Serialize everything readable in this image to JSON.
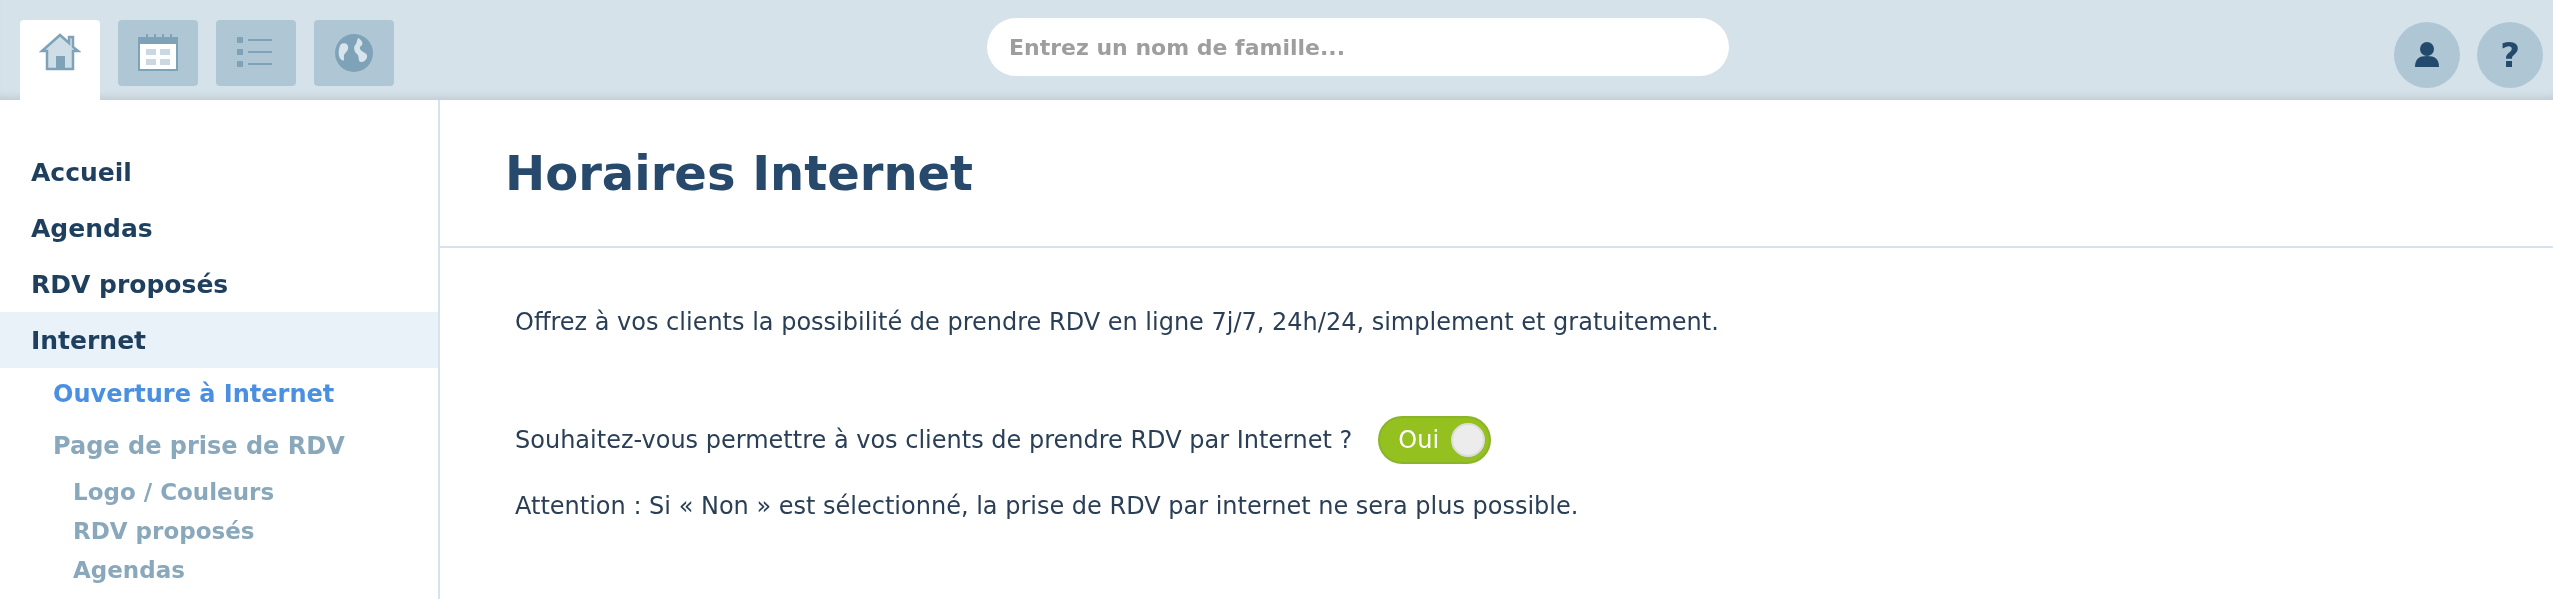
{
  "toolbar": {
    "tabs": [
      {
        "kind": "home",
        "selected": true
      },
      {
        "kind": "calendar",
        "selected": false
      },
      {
        "kind": "list",
        "selected": false
      },
      {
        "kind": "globe",
        "selected": false
      }
    ],
    "search": {
      "placeholder": "Entrez un nom de famille..."
    },
    "actions": [
      {
        "kind": "user"
      },
      {
        "kind": "help",
        "label": "?"
      }
    ]
  },
  "sidebar": {
    "items": [
      {
        "label": "Accueil",
        "selected": false
      },
      {
        "label": "Agendas",
        "selected": false
      },
      {
        "label": "RDV proposés",
        "selected": false
      },
      {
        "label": "Internet",
        "selected": true,
        "children": [
          {
            "label": "Ouverture à Internet",
            "selected": true
          },
          {
            "label": "Page de prise de RDV",
            "selected": false,
            "children": [
              {
                "label": "Logo / Couleurs",
                "selected": false
              },
              {
                "label": "RDV proposés",
                "selected": false
              },
              {
                "label": "Agendas",
                "selected": false
              }
            ]
          }
        ]
      }
    ]
  },
  "main": {
    "title": "Horaires Internet",
    "intro": "Offrez à vos clients la possibilité de prendre RDV en ligne 7j/7, 24h/24, simplement et gratuitement.",
    "question": "Souhaitez-vous permettre à vos clients de prendre RDV par Internet ?",
    "toggle": {
      "label": "Oui",
      "on": true
    },
    "warning": "Attention : Si « Non » est sélectionné, la prise de RDV par internet ne sera plus possible."
  }
}
